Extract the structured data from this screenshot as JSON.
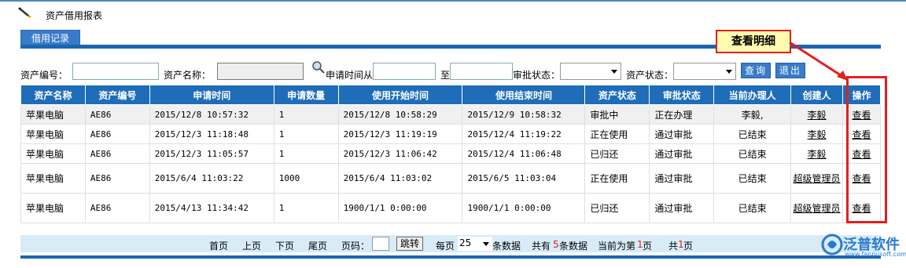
{
  "page": {
    "title": "资产借用报表"
  },
  "tabs": [
    {
      "label": "借用记录"
    }
  ],
  "callout": {
    "text": "查看明细"
  },
  "search": {
    "asset_no_label": "资产编号：",
    "asset_name_label": "资产名称：",
    "apply_time_label": "申请时间从",
    "to_label": "至",
    "approval_status_label": "审批状态：",
    "asset_status_label": "资产状态：",
    "query_button": "查询",
    "exit_button": "退出"
  },
  "table": {
    "headers": [
      "资产名称",
      "资产编号",
      "申请时间",
      "申请数量",
      "使用开始时间",
      "使用结束时间",
      "资产状态",
      "审批状态",
      "当前办理人",
      "创建人",
      "操作"
    ],
    "rows": [
      [
        "苹果电脑",
        "AE86",
        "2015/12/8 10:57:32",
        "1",
        "2015/12/8 10:58:29",
        "2015/12/9 10:58:32",
        "审批中",
        "正在办理",
        "李毅,",
        "李毅",
        "查看"
      ],
      [
        "苹果电脑",
        "AE86",
        "2015/12/3 11:18:48",
        "1",
        "2015/12/3 11:19:19",
        "2015/12/4 11:19:22",
        "正在使用",
        "通过审批",
        "已结束",
        "李毅",
        "查看"
      ],
      [
        "苹果电脑",
        "AE86",
        "2015/12/3 11:05:57",
        "1",
        "2015/12/3 11:06:42",
        "2015/12/4 11:06:48",
        "已归还",
        "通过审批",
        "已结束",
        "李毅",
        "查看"
      ],
      [
        "苹果电脑",
        "AE86",
        "2015/6/4 11:03:22",
        "1000",
        "2015/6/4 11:03:02",
        "2015/6/5 11:03:04",
        "正在使用",
        "通过审批",
        "已结束",
        "超级管理员",
        "查看"
      ],
      [
        "苹果电脑",
        "AE86",
        "2015/4/13 11:34:42",
        "1",
        "1900/1/1 0:00:00",
        "1900/1/1 0:00:00",
        "已归还",
        "通过审批",
        "已结束",
        "超级管理员",
        "查看"
      ]
    ]
  },
  "pager": {
    "first": "首页",
    "prev": "上页",
    "next": "下页",
    "last": "尾页",
    "page_label": "页码：",
    "jump_button": "跳转",
    "per_page_prefix": "每页",
    "per_page_value": "25",
    "per_page_suffix": "条数据",
    "total_prefix": "共有",
    "total_count": "5",
    "total_suffix": "条数据",
    "current_prefix": "当前为第",
    "current_page": "1",
    "current_suffix": "页",
    "pages_prefix": "共",
    "pages_total": "1",
    "pages_suffix": "页"
  },
  "logo": {
    "text": "泛普软件",
    "sub": "www.fanpusoft.com"
  },
  "colors": {
    "header_blue": "#1f6db8",
    "accent_red": "#e02020",
    "pager_bg": "#d8ecf8"
  }
}
